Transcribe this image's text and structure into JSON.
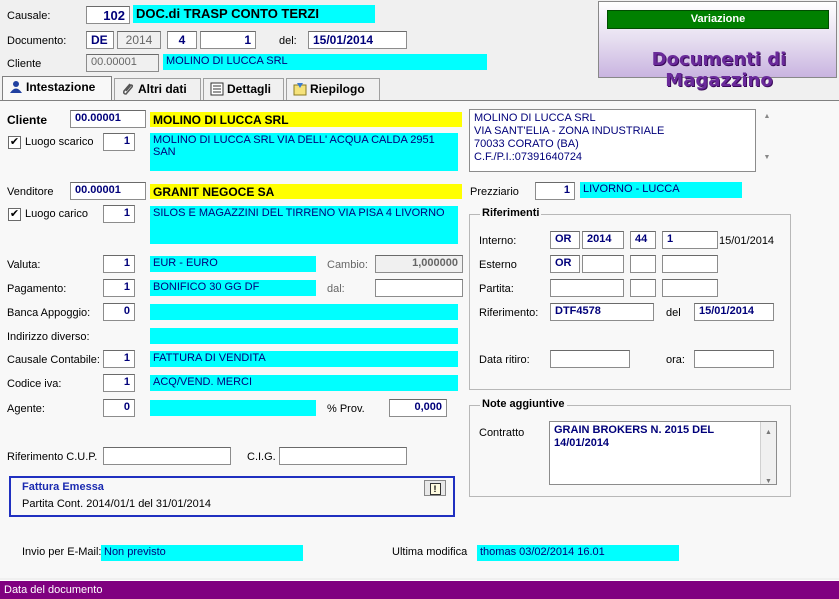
{
  "header": {
    "causale_label": "Causale:",
    "causale_code": "102",
    "causale_desc": "DOC.di TRASP CONTO TERZI",
    "documento_label": "Documento:",
    "doc_series": "DE",
    "doc_year": "2014",
    "doc_num1": "4",
    "doc_num2": "1",
    "del_label": "del:",
    "doc_date": "15/01/2014",
    "cliente_label": "Cliente",
    "cliente_code": "00.00001",
    "cliente_name": "MOLINO DI LUCCA SRL"
  },
  "banner": {
    "mode": "Variazione",
    "title": "Documenti di Magazzino",
    "mode_color": "#008000",
    "title_color": "#6a2a9a"
  },
  "tabs": [
    {
      "label": "Intestazione",
      "icon": "person-icon"
    },
    {
      "label": "Altri dati",
      "icon": "paperclip-icon"
    },
    {
      "label": "Dettagli",
      "icon": "list-icon"
    },
    {
      "label": "Riepilogo",
      "icon": "sum-icon"
    }
  ],
  "intestazione": {
    "cliente_label": "Cliente",
    "cliente_code": "00.00001",
    "cliente_name": "MOLINO DI LUCCA SRL",
    "luogo_scarico_label": "Luogo scarico",
    "luogo_scarico_checked": "✔",
    "luogo_scarico_num": "1",
    "luogo_scarico_desc": "MOLINO DI LUCCA SRL VIA DELL' ACQUA CALDA 2951 SAN",
    "address_lines": [
      "MOLINO DI LUCCA SRL",
      "VIA SANT'ELIA - ZONA INDUSTRIALE",
      "70033 CORATO (BA)",
      "C.F./P.I.:07391640724"
    ],
    "venditore_label": "Venditore",
    "venditore_code": "00.00001",
    "venditore_name": "GRANIT NEGOCE SA",
    "prezziario_label": "Prezziario",
    "prezziario_num": "1",
    "prezziario_desc": "LIVORNO - LUCCA",
    "luogo_carico_label": "Luogo carico",
    "luogo_carico_checked": "✔",
    "luogo_carico_num": "1",
    "luogo_carico_desc": "SILOS E MAGAZZINI DEL TIRRENO VIA PISA 4 LIVORNO",
    "valuta_label": "Valuta:",
    "valuta_num": "1",
    "valuta_desc": "EUR - EURO",
    "cambio_label": "Cambio:",
    "cambio_value": "1,000000",
    "pagamento_label": "Pagamento:",
    "pagamento_num": "1",
    "pagamento_desc": "BONIFICO 30 GG DF",
    "dal_label": "dal:",
    "dal_value": "",
    "banca_label": "Banca Appoggio:",
    "banca_num": "0",
    "banca_desc": "",
    "indirizzo_label": "Indirizzo diverso:",
    "indirizzo_desc": "",
    "causale_cont_label": "Causale Contabile:",
    "causale_cont_num": "1",
    "causale_cont_desc": "FATTURA DI VENDITA",
    "codice_iva_label": "Codice iva:",
    "codice_iva_num": "1",
    "codice_iva_desc": "ACQ/VEND. MERCI",
    "agente_label": "Agente:",
    "agente_num": "0",
    "agente_desc": "",
    "prov_label": "% Prov.",
    "prov_value": "0,000",
    "cup_label": "Riferimento C.U.P.",
    "cup_value": "",
    "cig_label": "C.I.G.",
    "cig_value": ""
  },
  "riferimenti": {
    "title": "Riferimenti",
    "interno_label": "Interno:",
    "interno_series": "OR",
    "interno_year": "2014",
    "interno_num1": "44",
    "interno_num2": "1",
    "interno_date": "15/01/2014",
    "esterno_label": "Esterno",
    "esterno_series": "OR",
    "partita_label": "Partita:",
    "riferimento_label": "Riferimento:",
    "riferimento_value": "DTF4578",
    "del_label": "del",
    "riferimento_date": "15/01/2014",
    "data_ritiro_label": "Data ritiro:",
    "ora_label": "ora:"
  },
  "note": {
    "title": "Note aggiuntive",
    "contratto_label": "Contratto",
    "contratto_text": "GRAIN BROKERS N. 2015 DEL 14/01/2014"
  },
  "fattura": {
    "title": "Fattura Emessa",
    "partita": "Partita Cont. 2014/01/1 del 31/01/2014",
    "info_icon": "!"
  },
  "footer": {
    "email_label": "Invio per E-Mail:",
    "email_value": "Non previsto",
    "modifica_label": "Ultima modifica",
    "modifica_value": "thomas 03/02/2014 16.01"
  },
  "status_bar": {
    "text": "Data del documento",
    "color": "#800080"
  }
}
